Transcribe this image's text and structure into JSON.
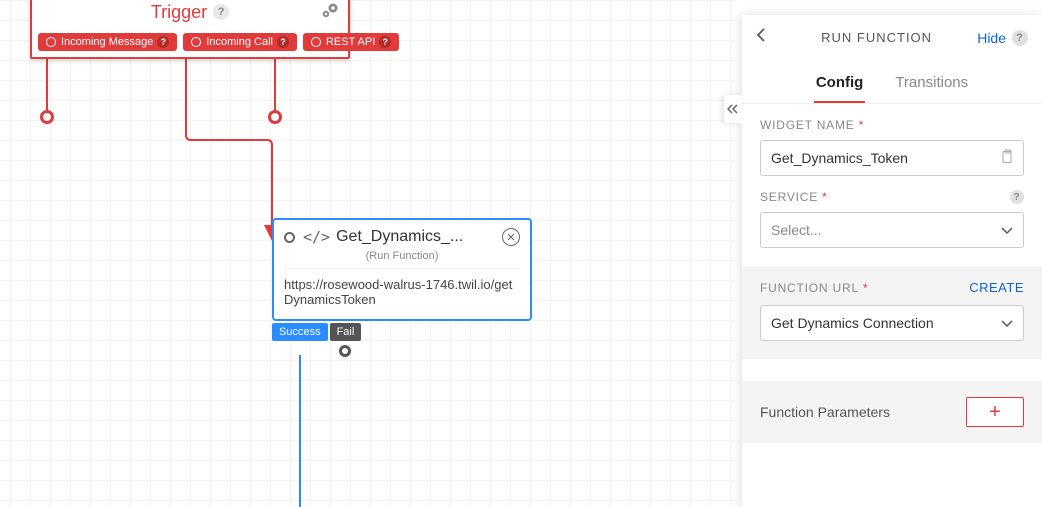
{
  "trigger": {
    "title": "Trigger",
    "events": [
      {
        "label": "Incoming Message"
      },
      {
        "label": "Incoming Call"
      },
      {
        "label": "REST API"
      }
    ]
  },
  "function_node": {
    "title": "Get_Dynamics_...",
    "subtitle": "(Run Function)",
    "url": "https://rosewood-walrus-1746.twil.io/getDynamicsToken",
    "outcomes": {
      "success": "Success",
      "fail": "Fail"
    }
  },
  "panel": {
    "title": "RUN FUNCTION",
    "hide": "Hide",
    "tabs": {
      "config": "Config",
      "transitions": "Transitions",
      "active": "config"
    },
    "widget_name": {
      "label": "WIDGET NAME",
      "value": "Get_Dynamics_Token"
    },
    "service": {
      "label": "SERVICE",
      "placeholder": "Select..."
    },
    "function_url": {
      "label": "FUNCTION URL",
      "create": "CREATE",
      "value": "Get Dynamics Connection"
    },
    "params": {
      "label": "Function Parameters",
      "add": "+"
    }
  }
}
